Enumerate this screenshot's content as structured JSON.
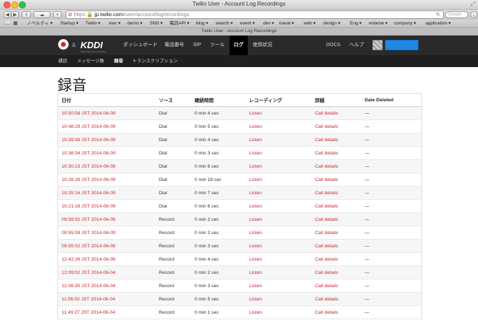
{
  "window": {
    "title": "Twilio User - Account Log Recordings"
  },
  "browser": {
    "url_prefix": "https",
    "url_host": "jp.twilio.com",
    "url_path": "/user/account/log/recordings",
    "search_placeholder": "Google",
    "bookmarks": [
      "ノベルティ ▾",
      "Startup ▾",
      "Twilio ▾",
      "kwc ▾",
      "demo ▾",
      "SNS ▾",
      "電話API ▾",
      "blog ▾",
      "search ▾",
      "event ▾",
      "dev ▾",
      "traval ▾",
      "web ▾",
      "design ▾",
      "Eng ▾",
      "entame ▾",
      "company ▾",
      "application ▾"
    ],
    "tab_title": "Twilio User - Account Log Recordings"
  },
  "brand": {
    "name": "KDDI",
    "ampersand": "&",
    "tagline": "KDDI Web Communications"
  },
  "nav": {
    "items": [
      "ダッシュボード",
      "電話番号",
      "SIP",
      "ツール",
      "ログ",
      "使用状況"
    ],
    "active": "ログ",
    "docs": "DOCS",
    "help": "ヘルプ"
  },
  "subnav": {
    "items": [
      "通話",
      "メッセージ数",
      "録音",
      "トランスクリプション"
    ],
    "active": "録音"
  },
  "page": {
    "title": "録音"
  },
  "table": {
    "headers": [
      "日付",
      "ソース",
      "継続時間",
      "レコーディング",
      "詳細",
      "Date Deleted"
    ],
    "rows": [
      [
        "10:50:58 JST 2014-06-09",
        "Dial",
        "0 min 4 sec",
        "Listen",
        "Call details",
        "—"
      ],
      [
        "10:48:29 JST 2014-06-09",
        "Dial",
        "0 min 5 sec",
        "Listen",
        "Call details",
        "—"
      ],
      [
        "10:39:38 JST 2014-06-09",
        "Dial",
        "0 min 4 sec",
        "Listen",
        "Call details",
        "—"
      ],
      [
        "10:38:34 JST 2014-06-09",
        "Dial",
        "0 min 3 sec",
        "Listen",
        "Call details",
        "—"
      ],
      [
        "10:30:23 JST 2014-06-09",
        "Dial",
        "0 min 6 sec",
        "Listen",
        "Call details",
        "—"
      ],
      [
        "10:28:28 JST 2014-06-09",
        "Dial",
        "0 min 18 sec",
        "Listen",
        "Call details",
        "—"
      ],
      [
        "10:25:16 JST 2014-06-09",
        "Dial",
        "0 min 7 sec",
        "Listen",
        "Call details",
        "—"
      ],
      [
        "10:21:18 JST 2014-06-09",
        "Dial",
        "0 min 6 sec",
        "Listen",
        "Call details",
        "—"
      ],
      [
        "09:59:32 JST 2014-06-09",
        "Record",
        "0 min 2 sec",
        "Listen",
        "Call details",
        "—"
      ],
      [
        "09:55:09 JST 2014-06-09",
        "Record",
        "0 min 2 sec",
        "Listen",
        "Call details",
        "—"
      ],
      [
        "09:55:02 JST 2014-06-09",
        "Record",
        "0 min 3 sec",
        "Listen",
        "Call details",
        "—"
      ],
      [
        "12:42:26 JST 2014-06-06",
        "Record",
        "0 min 4 sec",
        "Listen",
        "Call details",
        "—"
      ],
      [
        "12:09:02 JST 2014-06-04",
        "Record",
        "0 min 2 sec",
        "Listen",
        "Call details",
        "—"
      ],
      [
        "12:06:30 JST 2014-06-04",
        "Record",
        "0 min 3 sec",
        "Listen",
        "Call details",
        "—"
      ],
      [
        "11:56:02 JST 2014-06-04",
        "Record",
        "0 min 5 sec",
        "Listen",
        "Call details",
        "—"
      ],
      [
        "11:49:27 JST 2014-06-04",
        "Record",
        "0 min 1 sec",
        "Listen",
        "Call details",
        "—"
      ]
    ]
  },
  "colors": {
    "link": "#c9242b",
    "nav_bg": "#2a2a2a",
    "accent_button": "#1e88e5"
  }
}
